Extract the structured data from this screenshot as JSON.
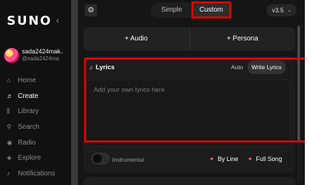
{
  "app": {
    "logo": "SUNO",
    "collapse_icon": "chevron-left-icon"
  },
  "user": {
    "name": "sada2424mak",
    "handle": "@sada2424ma"
  },
  "nav": {
    "items": [
      {
        "label": "Home",
        "icon": "home-icon",
        "active": false
      },
      {
        "label": "Create",
        "icon": "music-note-icon",
        "active": true
      },
      {
        "label": "Library",
        "icon": "library-icon",
        "active": false
      },
      {
        "label": "Search",
        "icon": "search-icon",
        "active": false
      },
      {
        "label": "Radio",
        "icon": "radio-icon",
        "active": false
      },
      {
        "label": "Explore",
        "icon": "explore-icon",
        "active": false
      },
      {
        "label": "Notifications",
        "icon": "bell-icon",
        "active": false
      }
    ]
  },
  "header": {
    "modes": [
      "Simple",
      "Custom"
    ],
    "selected_mode": "Custom",
    "version": "v3.5"
  },
  "add_row": {
    "audio_label": "+ Audio",
    "persona_label": "+ Persona"
  },
  "lyrics": {
    "title": "Lyrics",
    "auto_label": "Auto",
    "write_label": "Write Lyrics",
    "placeholder": "Add your own lyrics here"
  },
  "options": {
    "instrumental_label": "Instrumental",
    "instrumental_on": false,
    "byline_label": "By Line",
    "fullsong_label": "Full Song"
  },
  "colors": {
    "highlight": "#e00000",
    "accent": "#ff5fa8"
  }
}
